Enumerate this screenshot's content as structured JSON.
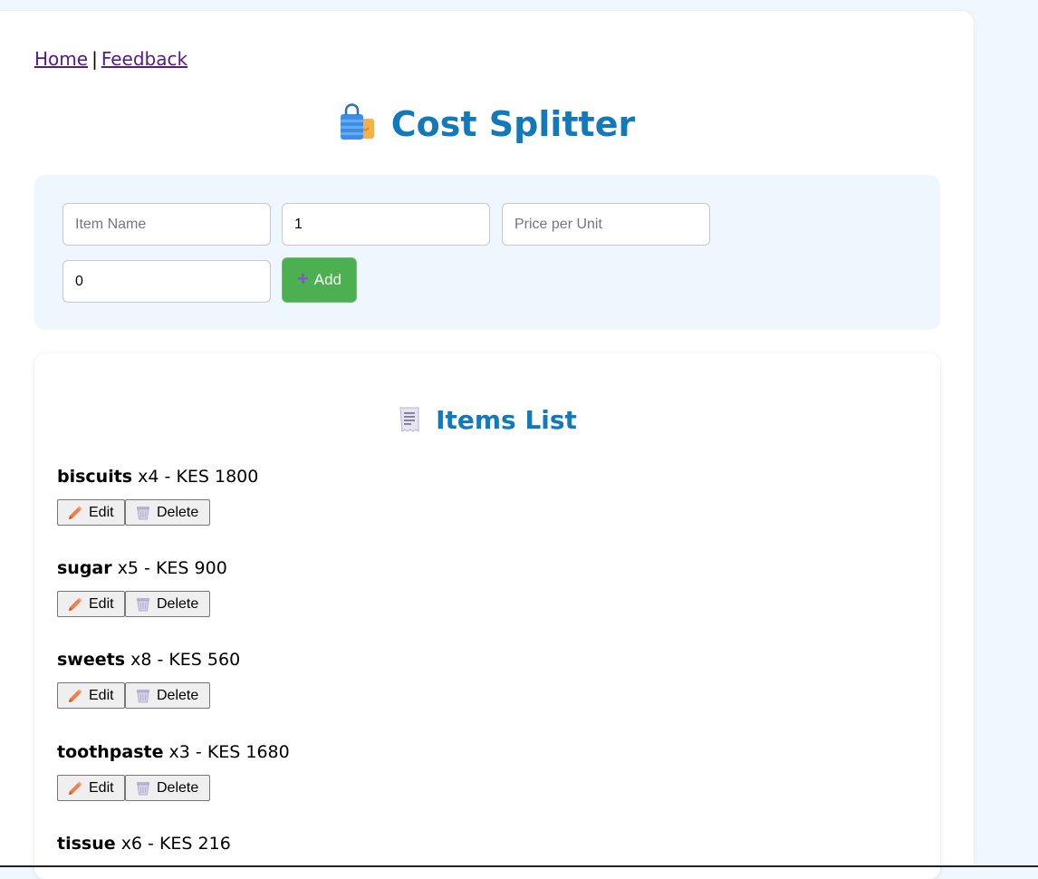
{
  "nav": {
    "home_label": "Home",
    "separator": "|",
    "feedback_label": "Feedback"
  },
  "header": {
    "title": "Cost Splitter",
    "icon": "shopping-bag-icon"
  },
  "form": {
    "item_name": {
      "value": "",
      "placeholder": "Item Name"
    },
    "quantity": {
      "value": "1",
      "placeholder": ""
    },
    "price_per_unit": {
      "value": "",
      "placeholder": "Price per Unit"
    },
    "extra_field": {
      "value": "0",
      "placeholder": ""
    },
    "add_button_label": "Add",
    "add_button_icon": "plus-icon"
  },
  "items_list": {
    "title": "Items List",
    "icon": "receipt-icon",
    "edit_label": "Edit",
    "delete_label": "Delete",
    "items": [
      {
        "name": "biscuits",
        "detail": "x4 - KES 1800"
      },
      {
        "name": "sugar",
        "detail": "x5 - KES 900"
      },
      {
        "name": "sweets",
        "detail": "x8 - KES 560"
      },
      {
        "name": "toothpaste",
        "detail": "x3 - KES 1680"
      },
      {
        "name": "tissue",
        "detail": "x6 - KES 216"
      }
    ]
  },
  "colors": {
    "accent": "#1479b8",
    "add_button": "#4caf50",
    "panel_background": "#eef6fe",
    "page_background": "#f1f7fe"
  }
}
